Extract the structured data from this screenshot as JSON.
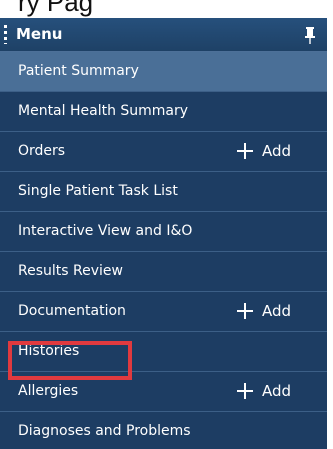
{
  "page_heading_partial": "ry Pag",
  "menu": {
    "title": "Menu",
    "pin_icon": "pin-icon",
    "items": [
      {
        "label": "Patient Summary",
        "selected": true
      },
      {
        "label": "Mental Health Summary"
      },
      {
        "label": "Orders",
        "add_label": "Add"
      },
      {
        "label": "Single Patient Task List"
      },
      {
        "label": "Interactive View and I&O"
      },
      {
        "label": "Results Review"
      },
      {
        "label": "Documentation",
        "add_label": "Add"
      },
      {
        "label": "Histories"
      },
      {
        "label": "Allergies",
        "add_label": "Add",
        "highlighted": true
      },
      {
        "label": "Diagnoses and Problems"
      }
    ]
  },
  "colors": {
    "panel_bg": "#1d3d63",
    "selected_bg": "#4a6f97",
    "highlight_border": "#e03a3f",
    "text": "#ffffff"
  }
}
